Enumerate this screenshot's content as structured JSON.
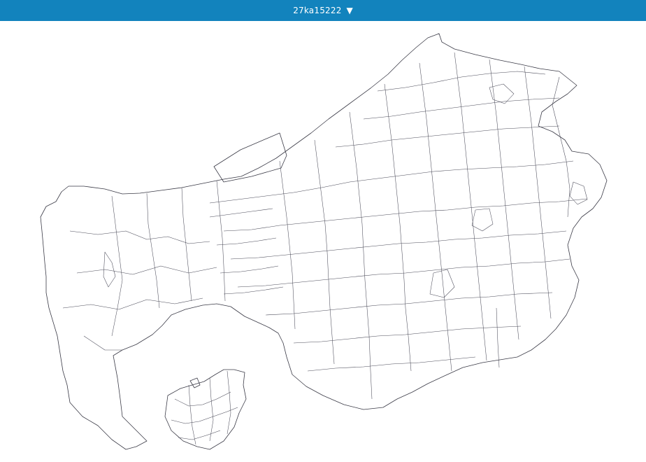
{
  "header": {
    "title": "27ka15222",
    "caret_icon": "triangle-down-icon",
    "background_color": "#1283bd",
    "text_color": "#ffffff"
  },
  "map": {
    "stroke_color": "#3a3a46",
    "background_color": "#ffffff"
  }
}
